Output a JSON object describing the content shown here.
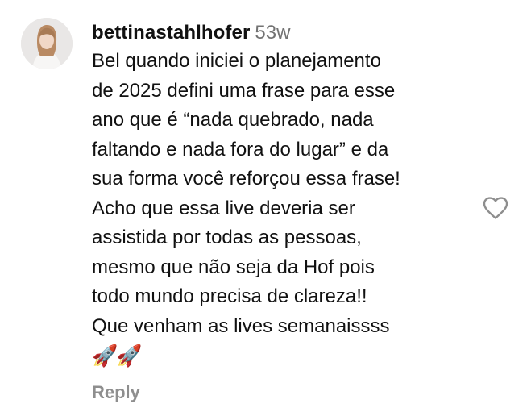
{
  "comment": {
    "username": "bettinastahlhofer",
    "time": "53w",
    "lines": [
      "Bel quando iniciei o planejamento",
      "de 2025 defini uma frase para esse",
      "ano que é “nada quebrado, nada",
      "faltando e nada fora do lugar” e da",
      "sua forma você reforçou essa frase!",
      "Acho que essa live deveria ser",
      "assistida por todas as pessoas,",
      "mesmo que não seja da Hof pois",
      "todo mundo precisa de clareza!!",
      "Que venham as lives semanaissss"
    ],
    "emoji": "🚀🚀",
    "reply_label": "Reply",
    "like_icon": "heart-outline-icon"
  }
}
